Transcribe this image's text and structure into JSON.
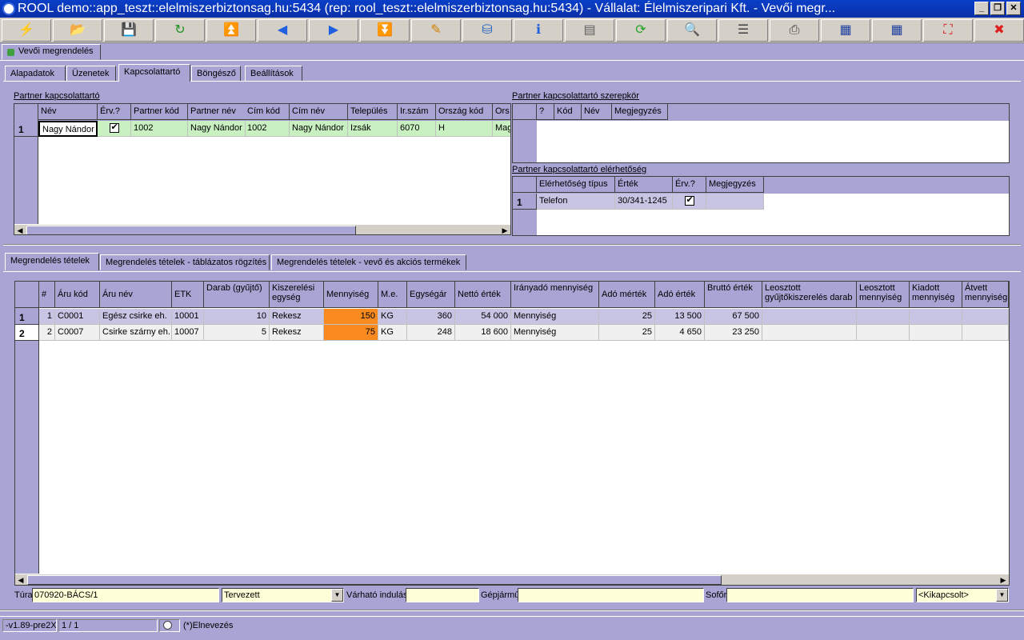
{
  "window": {
    "title": "ROOL demo::app_teszt::elelmiszerbiztonsag.hu:5434 (rep: rool_teszt::elelmiszerbiztonsag.hu:5434) - Vállalat: Élelmiszeripari Kft. - Vevői megr...",
    "min": "_",
    "restore": "❐",
    "close": "✕"
  },
  "toolbar": [
    {
      "name": "wizard",
      "glyph": "⚡",
      "color": "#e07010"
    },
    {
      "name": "open",
      "glyph": "📂",
      "color": "#2060c0"
    },
    {
      "name": "save",
      "glyph": "💾",
      "color": "#2040a0"
    },
    {
      "name": "refresh",
      "glyph": "↻",
      "color": "#209020"
    },
    {
      "name": "first",
      "glyph": "⏫",
      "color": "#2060e0"
    },
    {
      "name": "prev",
      "glyph": "◀",
      "color": "#2060e0"
    },
    {
      "name": "next",
      "glyph": "▶",
      "color": "#2060e0"
    },
    {
      "name": "last",
      "glyph": "⏬",
      "color": "#2060e0"
    },
    {
      "name": "edit",
      "glyph": "✎",
      "color": "#d08000"
    },
    {
      "name": "database",
      "glyph": "⛁",
      "color": "#2060c0"
    },
    {
      "name": "info",
      "glyph": "ℹ",
      "color": "#2060e0"
    },
    {
      "name": "layout",
      "glyph": "▤",
      "color": "#606060"
    },
    {
      "name": "sync",
      "glyph": "⟳",
      "color": "#20a020"
    },
    {
      "name": "search",
      "glyph": "🔍",
      "color": "#606060"
    },
    {
      "name": "columns",
      "glyph": "☰",
      "color": "#404040"
    },
    {
      "name": "print",
      "glyph": "⎙",
      "color": "#404040"
    },
    {
      "name": "grid-export",
      "glyph": "▦",
      "color": "#2040a0"
    },
    {
      "name": "grid-import",
      "glyph": "▦",
      "color": "#2040a0"
    },
    {
      "name": "fit",
      "glyph": "⛶",
      "color": "#d02020"
    },
    {
      "name": "exit",
      "glyph": "✖",
      "color": "#e02020"
    }
  ],
  "doc_tab": "Vevői megrendelés",
  "top_tabs": [
    "Alapadatok",
    "Üzenetek",
    "Kapcsolattartó",
    "Böngésző",
    "Beállítások"
  ],
  "contact": {
    "title": "Partner kapcsolattartó",
    "columns": [
      "Név",
      "Érv.?",
      "Partner kód",
      "Partner név",
      "Cím kód",
      "Cím név",
      "Település",
      "Ir.szám",
      "Ország kód",
      "Ors"
    ],
    "rows": [
      {
        "num": "1",
        "nev": "Nagy Nándor",
        "partner_kod": "1002",
        "partner_nev": "Nagy Nándor",
        "cim_kod": "1002",
        "cim_nev": "Nagy Nándor",
        "telepules": "Izsák",
        "irszam": "6070",
        "orszag_kod": "H",
        "ors": "Mag"
      }
    ]
  },
  "role": {
    "title": "Partner kapcsolattartó szerepkör",
    "columns": [
      "?",
      "Kód",
      "Név",
      "Megjegyzés"
    ]
  },
  "reach": {
    "title": "Partner kapcsolattartó elérhetőség",
    "columns": [
      "Elérhetőség típus",
      "Érték",
      "Érv.?",
      "Megjegyzés"
    ],
    "rows": [
      {
        "num": "1",
        "tipus": "Telefon",
        "ertek": "30/341-1245"
      }
    ]
  },
  "bottom_tabs": [
    "Megrendelés tételek",
    "Megrendelés tételek - táblázatos rögzítés",
    "Megrendelés tételek - vevő és akciós termékek"
  ],
  "items": {
    "columns": [
      "#",
      "Áru kód",
      "Áru név",
      "ETK",
      "Darab (gyűjtő)",
      "Kiszerelési egység",
      "Mennyiség",
      "M.e.",
      "Egységár",
      "Nettó érték",
      "Irányadó mennyiség",
      "Adó mérték",
      "Adó érték",
      "Bruttó érték",
      "Leosztott gyűjtőkiszerelés darab",
      "Leosztott mennyiség",
      "Kiadott mennyiség",
      "Átvett mennyiség"
    ],
    "rows": [
      {
        "rownum": "1",
        "n": "1",
        "kod": "C0001",
        "nev": "Egész csirke eh.",
        "etk": "10001",
        "darab": "10",
        "kisz": "Rekesz",
        "menny": "150",
        "me": "KG",
        "egysegar": "360",
        "netto": "54 000",
        "iranyado": "Mennyiség",
        "ado_m": "25",
        "ado_e": "13 500",
        "brutto": "67 500"
      },
      {
        "rownum": "2",
        "n": "2",
        "kod": "C0007",
        "nev": "Csirke szárny eh.",
        "etk": "10007",
        "darab": "5",
        "kisz": "Rekesz",
        "menny": "75",
        "me": "KG",
        "egysegar": "248",
        "netto": "18 600",
        "iranyado": "Mennyiség",
        "ado_m": "25",
        "ado_e": "4 650",
        "brutto": "23 250"
      }
    ]
  },
  "footer": {
    "tura_label": "Túra",
    "tura_value": "070920-BÁCS/1",
    "status_value": "Tervezett",
    "varhato_label": "Várható indulás",
    "varhato_value": "",
    "gepjarmu_label": "Gépjármű",
    "gepjarmu_value": "",
    "sofor_label": "Sofőr",
    "sofor_value": "",
    "kapcsolo_value": "<Kikapcsolt>"
  },
  "statusbar": {
    "version": "-v1.89-pre2X",
    "page": "1 / 1",
    "legend": "(*)Elnevezés"
  },
  "colors": {
    "titlebar": "#0a3fc8",
    "body": "#a8a4d4",
    "row_highlight": "#c8f0c0",
    "qty_highlight": "#f88a20",
    "input_bg": "#ffffd8"
  }
}
